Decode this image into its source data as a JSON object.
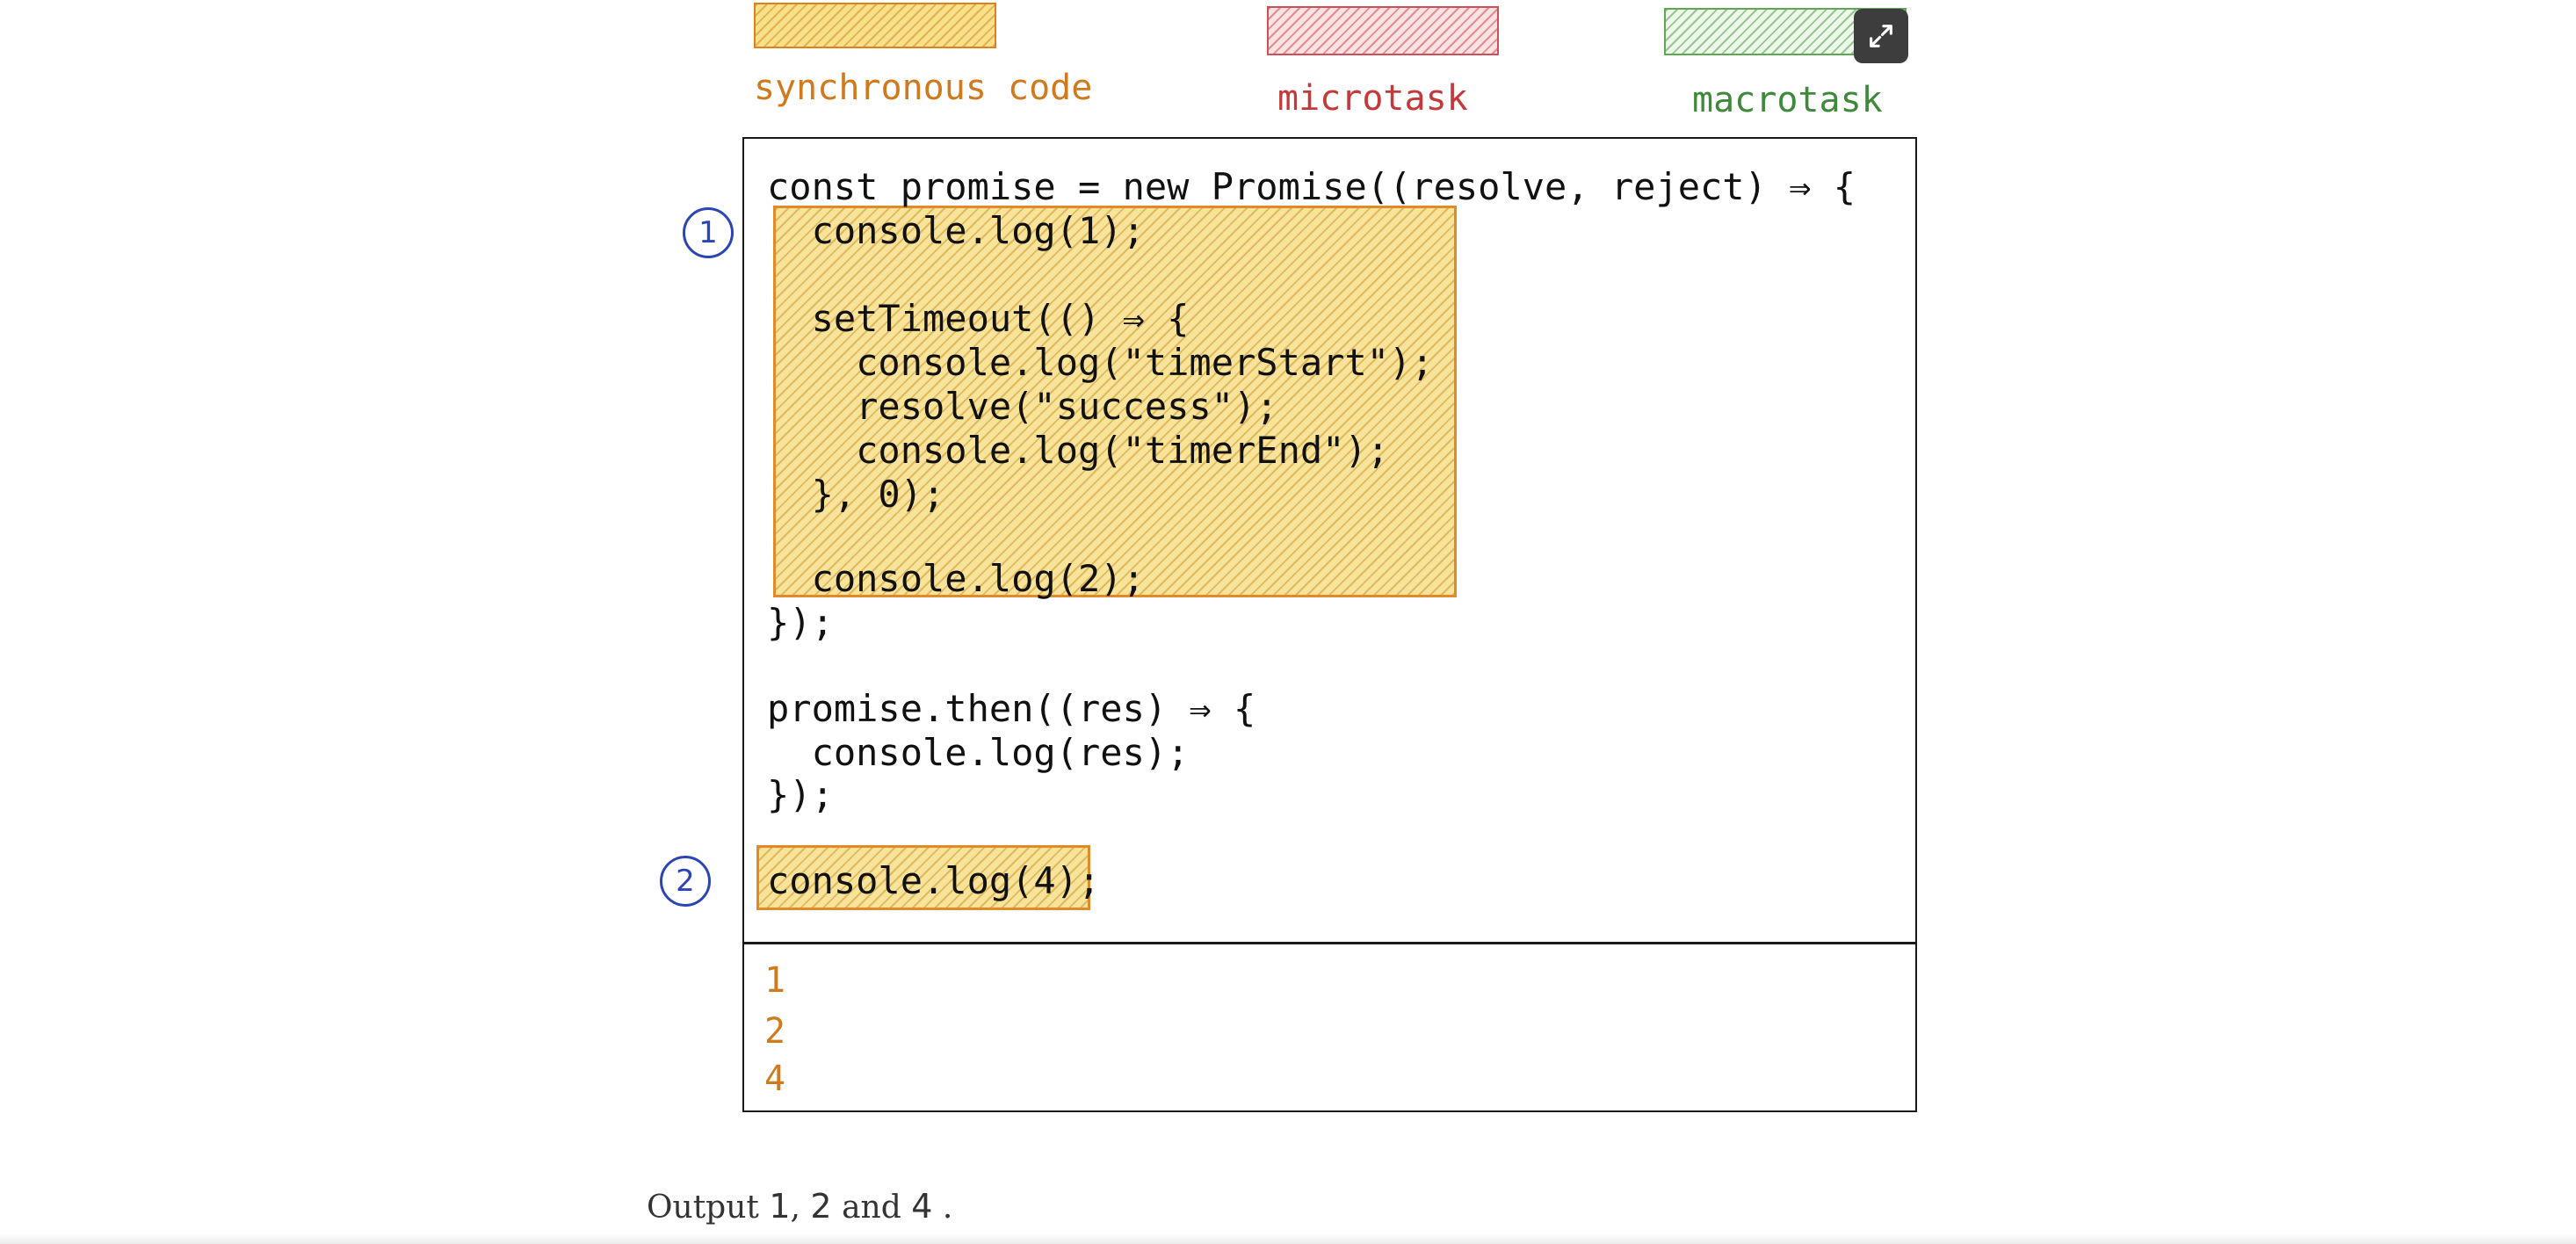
{
  "legend": {
    "items": [
      {
        "label": "synchronous code",
        "color": "#d07a1e"
      },
      {
        "label": "microtask",
        "color": "#c43a3a"
      },
      {
        "label": "macrotask",
        "color": "#3f8a3a"
      }
    ],
    "expand_icon": "expand-arrows-icon"
  },
  "code": {
    "lines": [
      "const promise = new Promise((resolve, reject) ⇒ {",
      "  console.log(1);",
      "",
      "  setTimeout(() ⇒ {",
      "    console.log(\"timerStart\");",
      "    resolve(\"success\");",
      "    console.log(\"timerEnd\");",
      "  }, 0);",
      "",
      "  console.log(2);",
      "});",
      "",
      "promise.then((res) ⇒ {",
      "  console.log(res);",
      "});",
      "",
      "console.log(4);"
    ],
    "highlight_color": "#e08a2a"
  },
  "markers": [
    "1",
    "2"
  ],
  "output": {
    "lines": [
      "1",
      "2",
      "4"
    ],
    "color": "#d07a1e"
  },
  "caption": {
    "prefix": "Output",
    "n1": "1",
    "sep1": ",",
    "n2": "2",
    "and": "and",
    "n3": "4",
    "end": "."
  }
}
